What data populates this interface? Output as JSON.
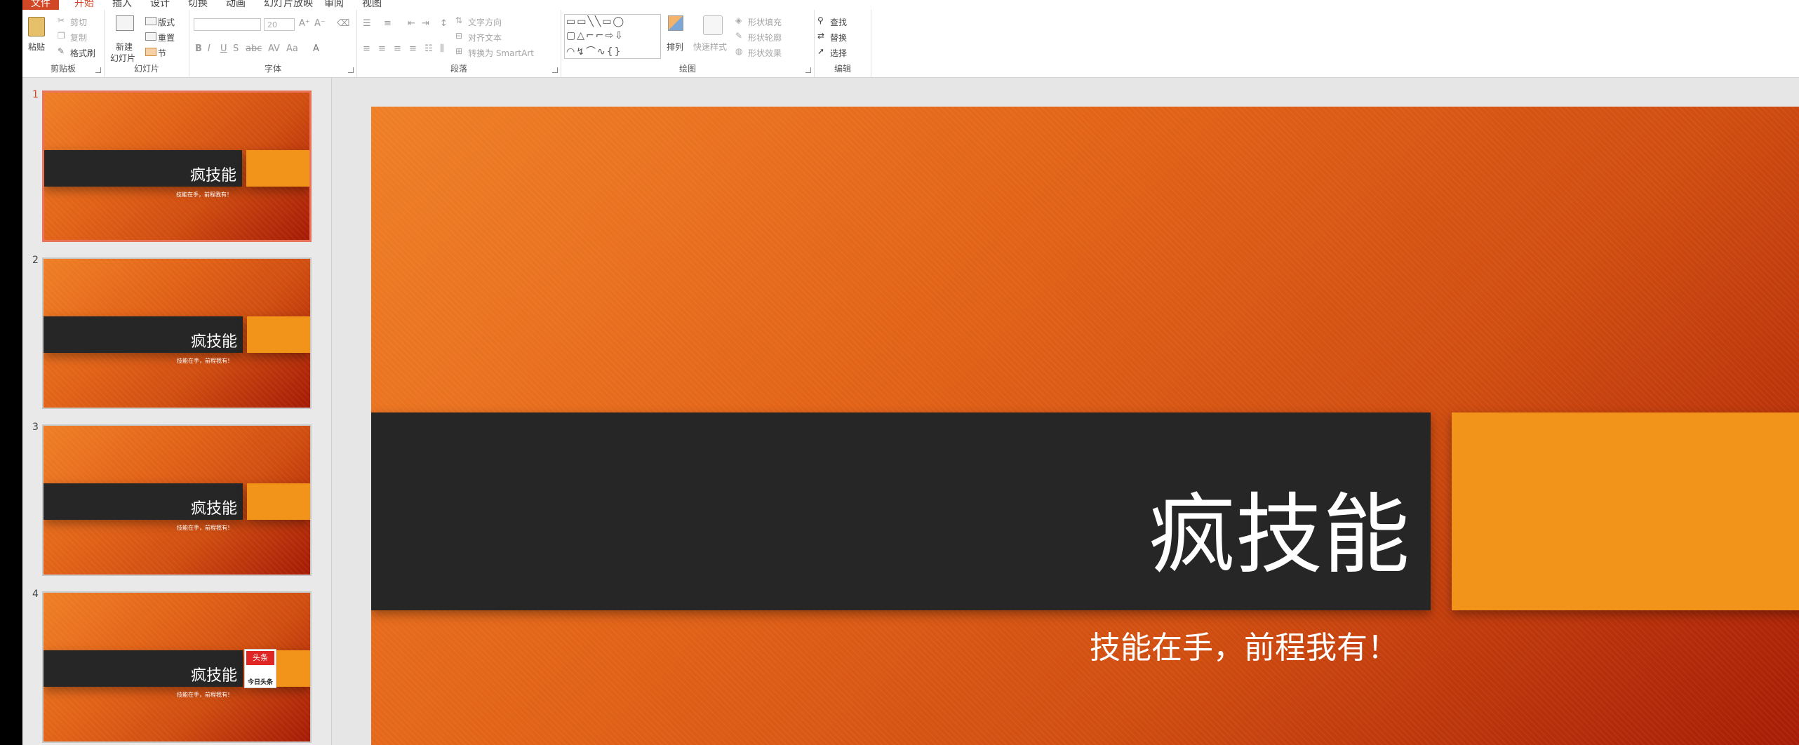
{
  "tabs": [
    {
      "label": "文件"
    },
    {
      "label": "开始"
    },
    {
      "label": "插入"
    },
    {
      "label": "设计"
    },
    {
      "label": "切换"
    },
    {
      "label": "动画"
    },
    {
      "label": "幻灯片放映"
    },
    {
      "label": "审阅"
    },
    {
      "label": "视图"
    }
  ],
  "ribbon": {
    "clipboard": {
      "label": "剪贴板",
      "paste": "粘贴",
      "cut": "剪切",
      "copy": "复制",
      "painter": "格式刷"
    },
    "slides": {
      "label": "幻灯片",
      "new_slide_1": "新建",
      "new_slide_2": "幻灯片",
      "layout": "版式",
      "reset": "重置",
      "section": "节"
    },
    "font": {
      "label": "字体",
      "size": "20"
    },
    "paragraph": {
      "label": "段落",
      "text_direction": "文字方向",
      "align_text": "对齐文本",
      "smartart": "转换为 SmartArt"
    },
    "drawing": {
      "label": "绘图",
      "arrange": "排列",
      "quick_styles": "快速样式",
      "shape_fill": "形状填充",
      "shape_outline": "形状轮廓",
      "shape_effects": "形状效果"
    },
    "editing": {
      "label": "编辑",
      "find": "查找",
      "replace": "替换",
      "select": "选择"
    }
  },
  "slide": {
    "title": "疯技能",
    "subtitle": "技能在手，前程我有！",
    "thumb_subtitle": "技能在手，前程我有！"
  },
  "thumbnails": [
    {
      "number": "1"
    },
    {
      "number": "2"
    },
    {
      "number": "3"
    },
    {
      "number": "4"
    }
  ],
  "logo": {
    "top": "头条",
    "bottom": "今日头条"
  },
  "colors": {
    "accent": "#d24726",
    "bar": "#262626",
    "orange_block": "#f19419",
    "slide_light": "#ef7f26",
    "slide_dark": "#a51a05"
  }
}
